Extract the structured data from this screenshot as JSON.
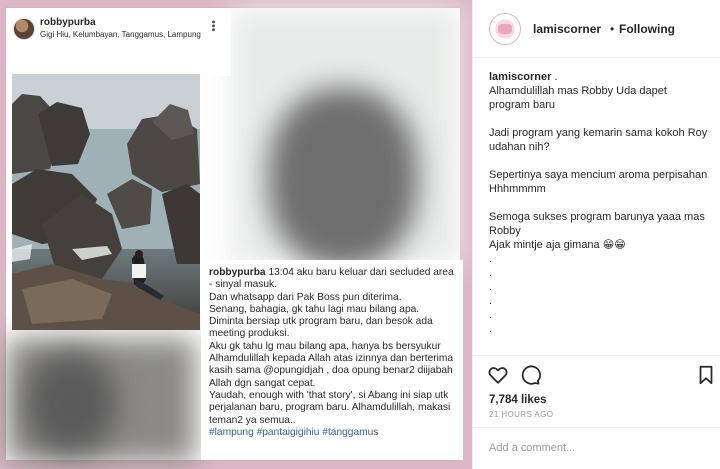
{
  "photo": {
    "username": "robbypurba",
    "location": "Gigi Hiu, Kelumbayan, Tanggamus, Lampung",
    "more_icon": "more-vertical-icon",
    "caption_user": "robbypurba",
    "caption_text": " 13:04 aku baru keluar dari secluded area - sinyal masuk.",
    "caption_lines": [
      "Dan whatsapp dari Pak Boss pun diterima.",
      "Senang, bahagia, gk tahu lagi mau bilang apa.",
      "Diminta bersiap utk program baru, dan besok ada meeting produksi.",
      "Aku gk tahu lg mau bilang apa, hanya bs bersyukur Alhamdulillah kepada Allah atas izinnya  dan berterima kasih sama @opungidjah , doa opung benar2 diijabah Allah dgn sangat cepat.",
      "Yaudah, enough with 'that story', si Abang ini siap utk perjalanan baru, program baru. Alhamdulillah, makasi teman2 ya semua.."
    ],
    "caption_tags": "#lampung #pantaigigihiu #tanggamus"
  },
  "post": {
    "username": "lamiscorner",
    "separator": "•",
    "follow_status": "Following",
    "caption_user": "lamiscorner",
    "caption_user_suffix": " .",
    "paragraphs": [
      "Alhamdulillah mas Robby Uda dapet program baru",
      "Jadi program yang kemarin sama kokoh Roy udahan nih?",
      "Sepertinya saya mencium aroma perpisahan\nHhhmmmm",
      "Semoga sukses program barunya yaaa mas Robby\nAjak mintje aja gimana 😁😁"
    ],
    "dots": [
      ".",
      ".",
      ".",
      ".",
      ".",
      "."
    ],
    "likes": "7,784 likes",
    "time": "21 HOURS AGO",
    "comment_placeholder": "Add a comment...",
    "icons": [
      "heart-icon",
      "comment-icon",
      "bookmark-icon"
    ]
  },
  "colors": {
    "frame_bg": "#dcb8c6",
    "tag_color": "#3b5c87",
    "text": "#262626",
    "muted": "#999999"
  }
}
